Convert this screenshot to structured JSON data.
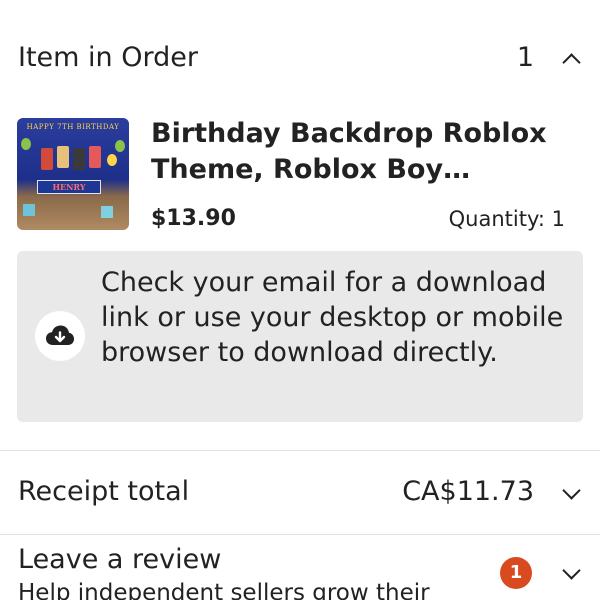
{
  "colors": {
    "accent_badge": "#d94a1e",
    "notice_background": "#e9e9e9",
    "text": "#222222"
  },
  "order_header": {
    "title": "Item in Order",
    "count": "1",
    "chevron_icon": "chevron-up-icon"
  },
  "item": {
    "title": "Birthday Backdrop Roblox Theme, Roblox Boy Birthd...",
    "price": "$13.90",
    "quantity": "Quantity: 1",
    "thumbnail": {
      "banner_text": "HAPPY 7TH BIRTHDAY",
      "name_text": "HENRY"
    }
  },
  "download_notice": {
    "icon": "cloud-download-icon",
    "text": "Check your email for a download link or use your desktop or mobile browser to download directly."
  },
  "receipt": {
    "label": "Receipt total",
    "value": "CA$11.73",
    "chevron_icon": "chevron-down-icon"
  },
  "review": {
    "title": "Leave a review",
    "subtitle": "Help independent sellers grow their",
    "badge_count": "1",
    "chevron_icon": "chevron-down-icon"
  }
}
